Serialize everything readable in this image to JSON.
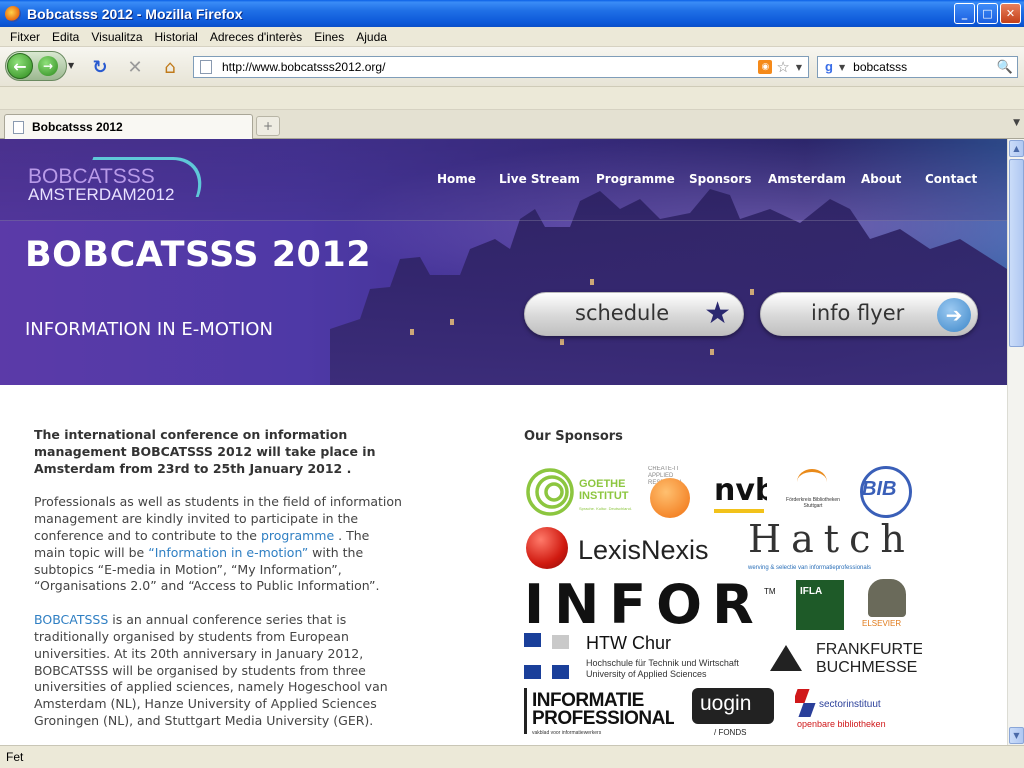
{
  "window": {
    "title": "Bobcatsss 2012 - Mozilla Firefox",
    "min": "_",
    "max": "□",
    "close": "✕"
  },
  "menu": [
    "Fitxer",
    "Edita",
    "Visualitza",
    "Historial",
    "Adreces d'interès",
    "Eines",
    "Ajuda"
  ],
  "toolbar": {
    "url": "http://www.bobcatsss2012.org/",
    "search_value": "bobcatsss"
  },
  "tab": {
    "label": "Bobcatsss 2012"
  },
  "site": {
    "logo_line1": "BOBCATSSS",
    "logo_line2": "AMSTERDAM2012",
    "nav": [
      "Home",
      "Live Stream",
      "Programme",
      "Sponsors",
      "Amsterdam",
      "About",
      "Contact"
    ],
    "hero_title": "BOBCATSSS 2012",
    "hero_subtitle": "INFORMATION IN E-MOTION",
    "btn_schedule": "schedule",
    "btn_flyer": "info flyer",
    "intro": "The international conference on information management BOBCATSSS 2012 will take place in Amsterdam from 23rd to 25th January 2012 .",
    "p2_a": "Professionals as well as students in the field of information management are kindly invited to participate in the conference and to contribute to the ",
    "p2_link1": "programme",
    "p2_b": " . The main topic will be ",
    "p2_link2": "“Information in e-motion”",
    "p2_c": " with the subtopics “E-media in Motion”, “My Information”, “Organisations 2.0” and “Access to Public Information”.",
    "p3_link": "BOBCATSSS",
    "p3_text": " is an annual conference series that is traditionally organised by students from European universities. At its 20th anniversary in January 2012, BOBCATSSS will be organised by students from three universities of applied sciences, namely Hogeschool van Amsterdam (NL), Hanze University of Applied Sciences Groningen (NL), and Stuttgart Media University (GER).",
    "sponsors_heading": "Our Sponsors",
    "sponsors": {
      "goethe": "GOETHE INSTITUT",
      "goethe_sub": "Sprache. Kultur. Deutschland.",
      "createit": "CREATE-IT APPLIED RESEARCH",
      "nvb": "nvb",
      "stuttgart": "Förderkreis Bibliotheken Stuttgart",
      "bib": "BIB",
      "lexis": "LexisNexis",
      "hatch": "Hatch",
      "hatch_sub": "werving & selectie van informatieprofessionals",
      "infor": "INFOR",
      "tm": "TM",
      "ifla": "IFLA",
      "elsevier": "ELSEVIER",
      "htw1": "HTW Chur",
      "htw2": "Hochschule für Technik und Wirtschaft",
      "htw3": "University of Applied Sciences",
      "ffm1": "FRANKFURTER",
      "ffm2": "BUCHMESSE",
      "ip1": "INFORMATIE",
      "ip2": "PROFESSIONAL",
      "ip3": "vakblad voor informatiewerkers",
      "uogin": "uogin",
      "uogin_sub": "/ FONDS",
      "sector1": "sectorinstituut",
      "sector2": "openbare bibliotheken"
    }
  },
  "status": "Fet",
  "colors": {
    "link": "#2f7fc3",
    "hero_purple": "#4e39a6"
  }
}
